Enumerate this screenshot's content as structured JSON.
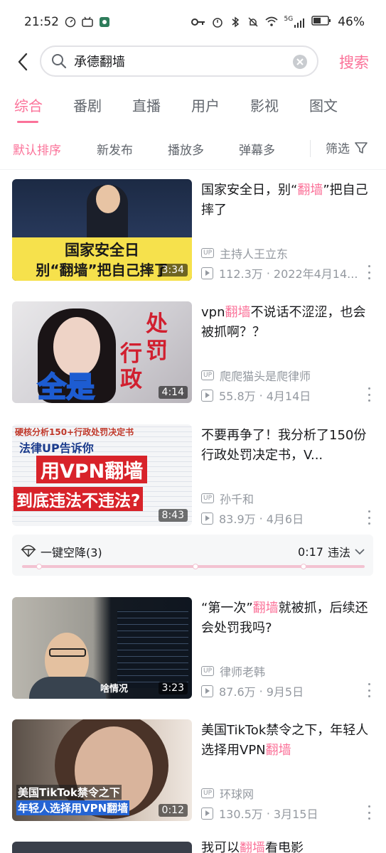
{
  "status_bar": {
    "time": "21:52",
    "battery": "46%",
    "signal": "5G"
  },
  "search": {
    "query": "承德翻墙",
    "submit_label": "搜索"
  },
  "tabs": [
    "综合",
    "番剧",
    "直播",
    "用户",
    "影视",
    "图文"
  ],
  "sort": {
    "options": [
      "默认排序",
      "新发布",
      "播放多",
      "弹幕多"
    ],
    "filter_label": "筛选"
  },
  "videos": [
    {
      "title_parts": [
        "国家安全日，别“",
        "翻墙",
        "”把自己摔了"
      ],
      "uploader": "主持人王立东",
      "views": "112.3万",
      "date": "2022年4月14...",
      "duration": "3:34",
      "thumb_text": [
        "国家安全日",
        "别“翻墙”把自己摔了"
      ]
    },
    {
      "title_parts": [
        "vpn",
        "翻墙",
        "不说话不涩涩，也会被抓啊？？"
      ],
      "uploader": "爬爬猫头是爬律师",
      "views": "55.8万",
      "date": "4月14日",
      "duration": "4:14",
      "thumb_text": [
        "处",
        "罚",
        "行",
        "政",
        "全是"
      ]
    },
    {
      "title_parts": [
        "不要再争了！我分析了150份行政处罚决定书，V...",
        "",
        ""
      ],
      "uploader": "孙千和",
      "views": "83.9万",
      "date": "4月6日",
      "duration": "8:43",
      "thumb_text": [
        "硬核分析150+行政处罚决定书",
        "法律UP告诉你",
        "用VPN翻墙",
        "到底违法不违法?"
      ]
    },
    {
      "title_parts": [
        "“第一次”",
        "翻墙",
        "就被抓，后续还会处罚我吗?"
      ],
      "uploader": "律师老韩",
      "views": "87.6万",
      "date": "9月5日",
      "duration": "3:23",
      "thumb_text": [
        "啥情况"
      ]
    },
    {
      "title_parts": [
        "美国TikTok禁令之下，年轻人选择用VPN",
        "翻墙",
        ""
      ],
      "uploader": "环球网",
      "views": "130.5万",
      "date": "3月15日",
      "duration": "0:12",
      "thumb_text": [
        "美国TikTok禁令之下",
        "年轻人选择用VPN翻墙"
      ]
    }
  ],
  "airdrop": {
    "label": "一键空降(3)",
    "time": "0:17",
    "tag": "违法"
  },
  "partial_title": [
    "我可以",
    "翻墙",
    "看电影"
  ],
  "colors": {
    "accent": "#fb7299",
    "meta": "#9499a0"
  }
}
